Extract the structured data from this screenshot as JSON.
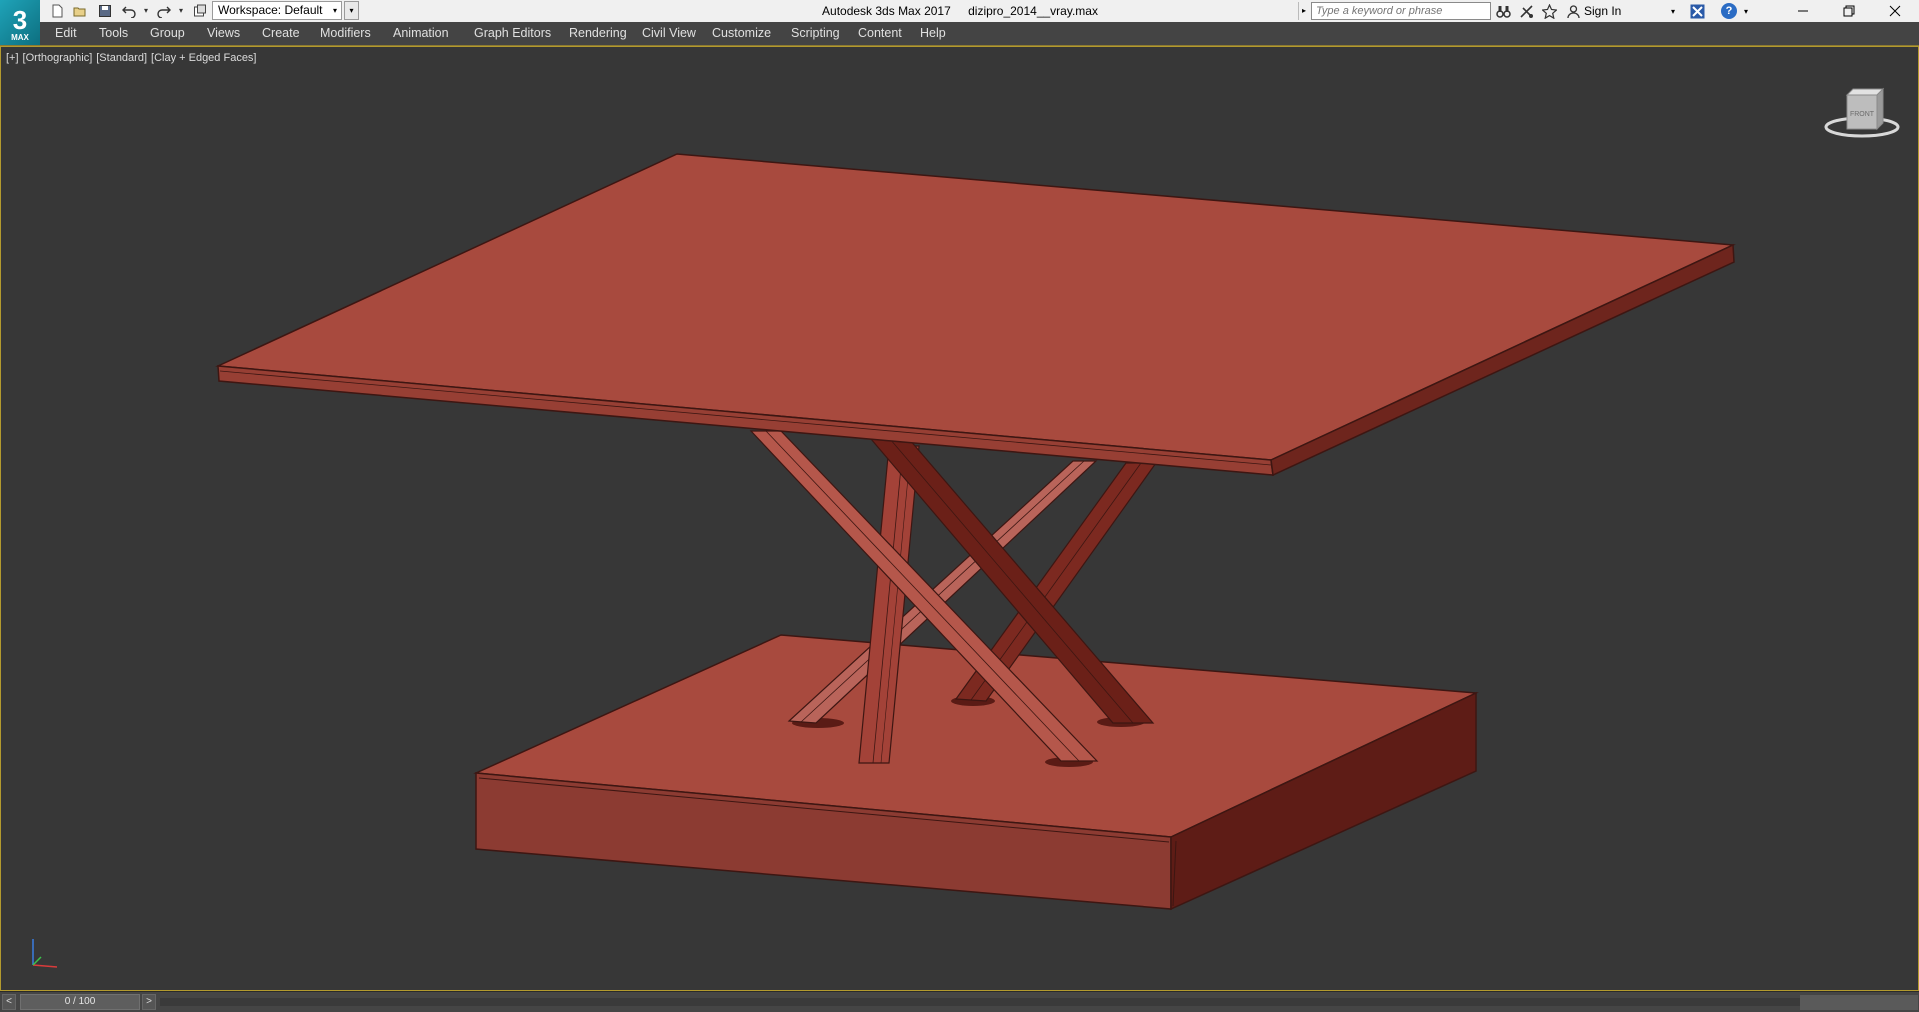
{
  "app": {
    "logo_text": "3",
    "logo_sub": "MAX",
    "title_app": "Autodesk 3ds Max 2017",
    "title_file": "dizipro_2014__vray.max"
  },
  "quick_access": {
    "icons": [
      "new-file-icon",
      "open-file-icon",
      "save-icon",
      "undo-icon",
      "redo-icon",
      "project-folder-icon"
    ]
  },
  "workspace": {
    "label": "Workspace: Default"
  },
  "search": {
    "placeholder": "Type a keyword or phrase"
  },
  "account": {
    "sign_in_label": "Sign In",
    "help_label": "?"
  },
  "menu": {
    "items": [
      "Edit",
      "Tools",
      "Group",
      "Views",
      "Create",
      "Modifiers",
      "Animation",
      "Graph Editors",
      "Rendering",
      "Civil View",
      "Customize",
      "Scripting",
      "Content",
      "Help"
    ]
  },
  "viewport": {
    "label_plus": "[+]",
    "label_view": "[Orthographic]",
    "label_shading_standard": "[Standard]",
    "label_shading_mode": "[Clay + Edged Faces]",
    "viewcube_label": "FRONT",
    "model_color": "#a84a3e",
    "background_color": "#373737"
  },
  "timeline": {
    "prev_label": "<",
    "next_label": ">",
    "frame_label": "0 / 100"
  },
  "colors": {
    "accent_border": "#b39a2e",
    "menubar_bg": "#444444",
    "titlebar_bg": "#f0f0f0"
  }
}
